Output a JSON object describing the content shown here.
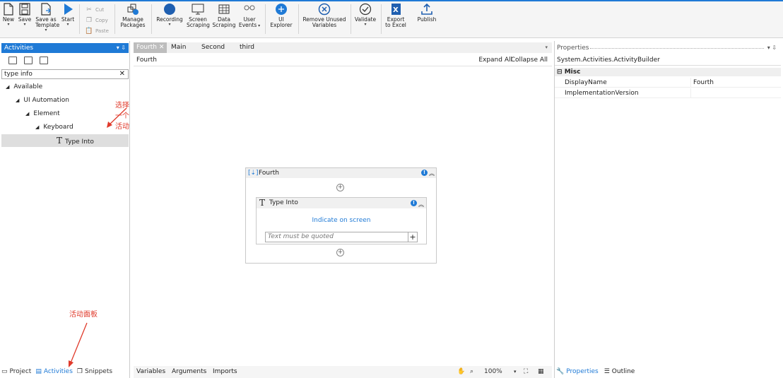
{
  "ribbon": {
    "new": "New",
    "save": "Save",
    "save_as_1": "Save as",
    "save_as_2": "Template",
    "start": "Start",
    "cut": "Cut",
    "copy": "Copy",
    "paste": "Paste",
    "manage_1": "Manage",
    "manage_2": "Packages",
    "recording": "Recording",
    "screen_1": "Screen",
    "screen_2": "Scraping",
    "data_1": "Data",
    "data_2": "Scraping",
    "user_1": "User",
    "user_2": "Events",
    "ui_1": "UI",
    "ui_2": "Explorer",
    "remove_1": "Remove Unused",
    "remove_2": "Variables",
    "validate": "Validate",
    "export_1": "Export",
    "export_2": "to Excel",
    "publish": "Publish"
  },
  "activities": {
    "title": "Activities",
    "search_value": "type info",
    "tree": {
      "available": "Available",
      "ui_automation": "UI Automation",
      "element": "Element",
      "keyboard": "Keyboard",
      "type_into": "Type Into"
    },
    "annotation_select": "选择一个活动",
    "annotation_panel": "活动面板",
    "footer": {
      "project": "Project",
      "activities": "Activities",
      "snippets": "Snippets"
    }
  },
  "designer": {
    "tabs": [
      "Fourth",
      "Main",
      "Second",
      "third"
    ],
    "title": "Fourth",
    "expand_all": "Expand All",
    "collapse_all": "Collapse All",
    "sequence_title": "Fourth",
    "type_into_title": "Type Into",
    "indicate": "Indicate on screen",
    "text_placeholder": "Text must be quoted",
    "footer": {
      "variables": "Variables",
      "arguments": "Arguments",
      "imports": "Imports",
      "zoom": "100%"
    }
  },
  "properties": {
    "title": "Properties",
    "type": "System.Activities.ActivityBuilder",
    "section": "Misc",
    "rows": [
      {
        "key": "DisplayName",
        "value": "Fourth"
      },
      {
        "key": "ImplementationVersion",
        "value": ""
      }
    ],
    "footer": {
      "properties": "Properties",
      "outline": "Outline"
    }
  },
  "colors": {
    "accent": "#1f7ad6",
    "annotation": "#e03a2b"
  }
}
